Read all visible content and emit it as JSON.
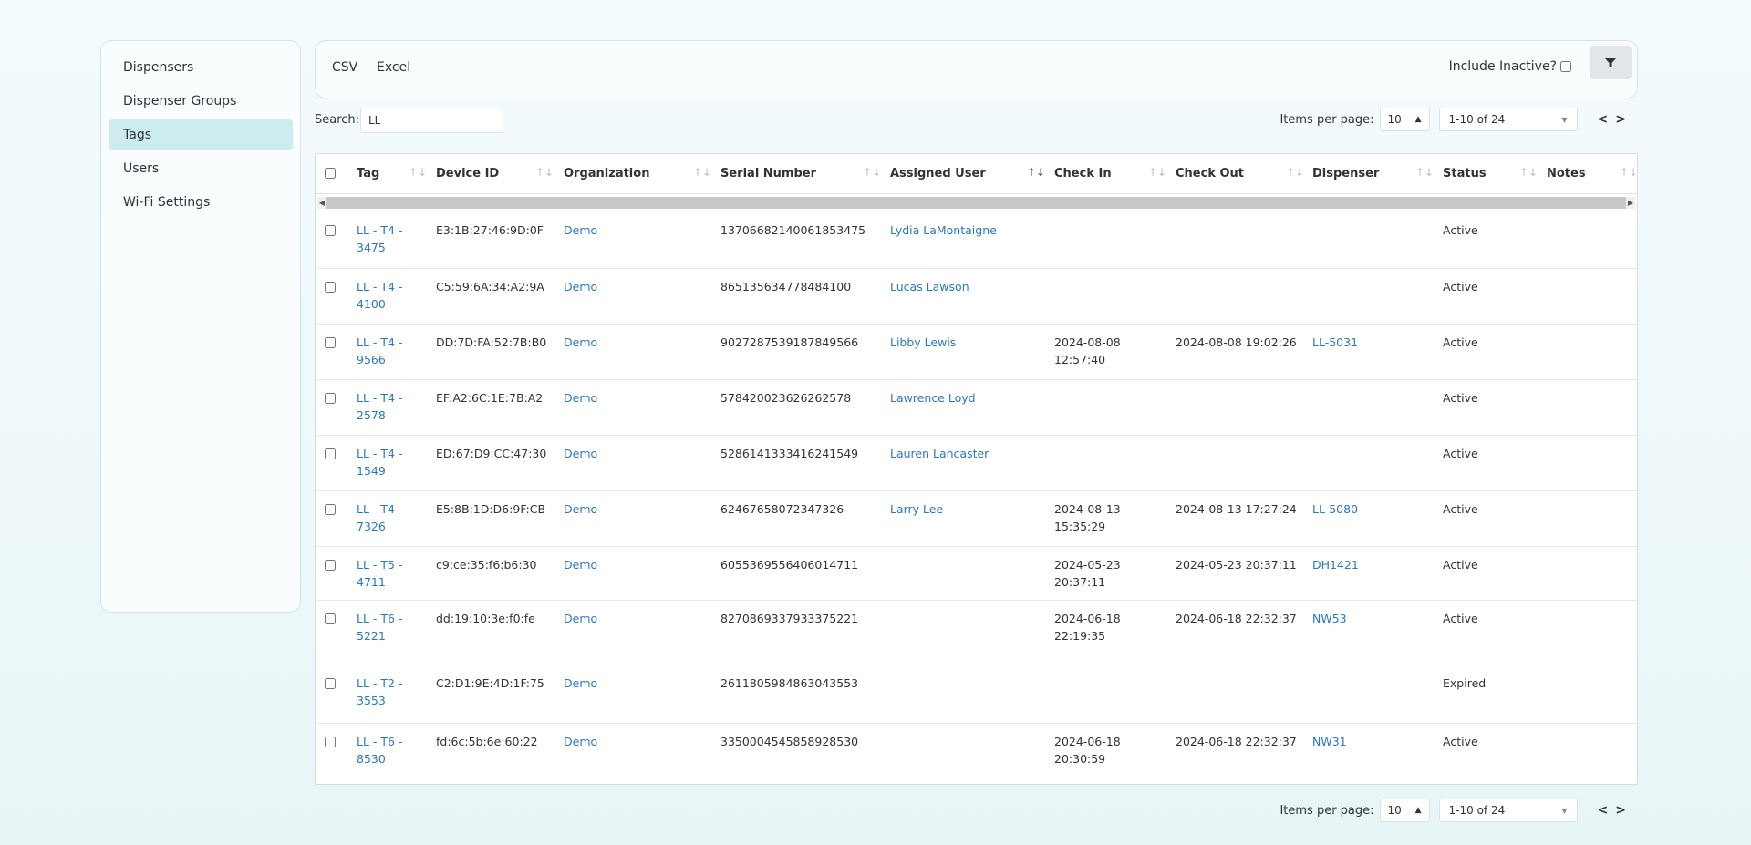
{
  "sidebar": {
    "items": [
      {
        "label": "Dispensers"
      },
      {
        "label": "Dispenser Groups"
      },
      {
        "label": "Tags"
      },
      {
        "label": "Users"
      },
      {
        "label": "Wi-Fi Settings"
      }
    ],
    "active_index": 2
  },
  "toolbar": {
    "csv_label": "CSV",
    "excel_label": "Excel",
    "include_inactive_label": "Include Inactive?",
    "include_inactive_checked": false,
    "filter_icon": "funnel-icon"
  },
  "search": {
    "label": "Search:",
    "value": "LL"
  },
  "pagination": {
    "items_per_page_label": "Items per page:",
    "items_per_page": "10",
    "range": "1-10 of 24",
    "prev_label": "<",
    "next_label": ">"
  },
  "table": {
    "columns": [
      {
        "key": "tag",
        "label": "Tag"
      },
      {
        "key": "device_id",
        "label": "Device ID"
      },
      {
        "key": "organization",
        "label": "Organization"
      },
      {
        "key": "serial",
        "label": "Serial Number"
      },
      {
        "key": "user",
        "label": "Assigned User"
      },
      {
        "key": "check_in",
        "label": "Check In"
      },
      {
        "key": "check_out",
        "label": "Check Out"
      },
      {
        "key": "dispenser",
        "label": "Dispenser"
      },
      {
        "key": "status",
        "label": "Status"
      },
      {
        "key": "notes",
        "label": "Notes"
      }
    ],
    "rows": [
      {
        "tag1": "LL - T4 -",
        "tag2": "3475",
        "device_id": "E3:1B:27:46:9D:0F",
        "organization": "Demo",
        "serial": "13706682140061853475",
        "user": "Lydia LaMontaigne",
        "check_in1": "",
        "check_in2": "",
        "check_out": "",
        "dispenser": "",
        "status": "Active",
        "notes": ""
      },
      {
        "tag1": "LL - T4 -",
        "tag2": "4100",
        "device_id": "C5:59:6A:34:A2:9A",
        "organization": "Demo",
        "serial": "865135634778484100",
        "user": "Lucas Lawson",
        "check_in1": "",
        "check_in2": "",
        "check_out": "",
        "dispenser": "",
        "status": "Active",
        "notes": ""
      },
      {
        "tag1": "LL - T4 -",
        "tag2": "9566",
        "device_id": "DD:7D:FA:52:7B:B0",
        "organization": "Demo",
        "serial": "9027287539187849566",
        "user": "Libby Lewis",
        "check_in1": "2024-08-08",
        "check_in2": "12:57:40",
        "check_out": "2024-08-08 19:02:26",
        "dispenser": "LL-5031",
        "status": "Active",
        "notes": ""
      },
      {
        "tag1": "LL - T4 -",
        "tag2": "2578",
        "device_id": "EF:A2:6C:1E:7B:A2",
        "organization": "Demo",
        "serial": "578420023626262578",
        "user": "Lawrence Loyd",
        "check_in1": "",
        "check_in2": "",
        "check_out": "",
        "dispenser": "",
        "status": "Active",
        "notes": ""
      },
      {
        "tag1": "LL - T4 -",
        "tag2": "1549",
        "device_id": "ED:67:D9:CC:47:30",
        "organization": "Demo",
        "serial": "5286141333416241549",
        "user": "Lauren Lancaster",
        "check_in1": "",
        "check_in2": "",
        "check_out": "",
        "dispenser": "",
        "status": "Active",
        "notes": ""
      },
      {
        "tag1": "LL - T4 -",
        "tag2": "7326",
        "device_id": "E5:8B:1D:D6:9F:CB",
        "organization": "Demo",
        "serial": "62467658072347326",
        "user": "Larry Lee",
        "check_in1": "2024-08-13",
        "check_in2": "15:35:29",
        "check_out": "2024-08-13 17:27:24",
        "dispenser": "LL-5080",
        "status": "Active",
        "notes": ""
      },
      {
        "tag1": "LL - T5 -",
        "tag2": "4711",
        "device_id": "c9:ce:35:f6:b6:30",
        "organization": "Demo",
        "serial": "6055369556406014711",
        "user": "",
        "check_in1": "2024-05-23",
        "check_in2": "20:37:11",
        "check_out": "2024-05-23 20:37:11",
        "dispenser": "DH1421",
        "status": "Active",
        "notes": ""
      },
      {
        "tag1": "LL - T6 -",
        "tag2": "5221",
        "device_id": "dd:19:10:3e:f0:fe",
        "organization": "Demo",
        "serial": "8270869337933375221",
        "user": "",
        "check_in1": "2024-06-18",
        "check_in2": "22:19:35",
        "check_out": "2024-06-18 22:32:37",
        "dispenser": "NW53",
        "status": "Active",
        "notes": ""
      },
      {
        "tag1": "LL - T2 -",
        "tag2": "3553",
        "device_id": "C2:D1:9E:4D:1F:75",
        "organization": "Demo",
        "serial": "2611805984863043553",
        "user": "",
        "check_in1": "",
        "check_in2": "",
        "check_out": "",
        "dispenser": "",
        "status": "Expired",
        "notes": ""
      },
      {
        "tag1": "LL - T6 -",
        "tag2": "8530",
        "device_id": "fd:6c:5b:6e:60:22",
        "organization": "Demo",
        "serial": "3350004545858928530",
        "user": "",
        "check_in1": "2024-06-18",
        "check_in2": "20:30:59",
        "check_out": "2024-06-18 22:32:37",
        "dispenser": "NW31",
        "status": "Active",
        "notes": ""
      }
    ]
  }
}
